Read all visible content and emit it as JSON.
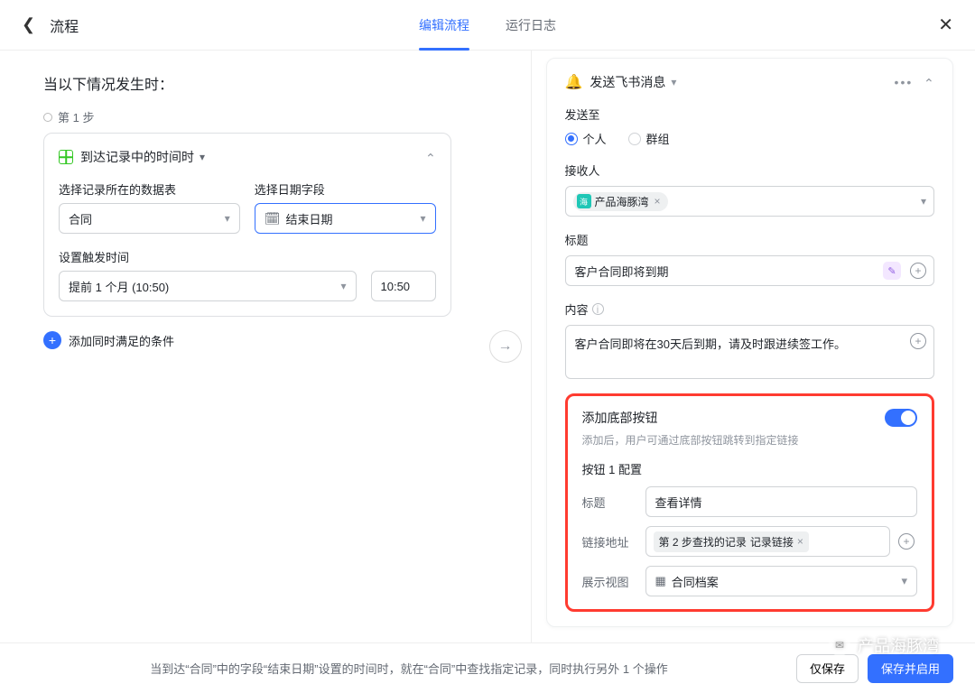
{
  "header": {
    "title": "流程",
    "tabs": [
      "编辑流程",
      "运行日志"
    ]
  },
  "left": {
    "section_title": "当以下情况发生时：",
    "step_label": "第 1 步",
    "card_title": "到达记录中的时间时",
    "label_table": "选择记录所在的数据表",
    "table_value": "合同",
    "label_date_field": "选择日期字段",
    "date_field_value": "结束日期",
    "label_trigger_time": "设置触发时间",
    "trigger_value": "提前 1 个月 (10:50)",
    "time_value": "10:50",
    "add_condition": "添加同时满足的条件"
  },
  "right": {
    "action_title": "发送飞书消息",
    "send_to_label": "发送至",
    "radio_person": "个人",
    "radio_group": "群组",
    "recipient_label": "接收人",
    "recipient_chip": "产品海豚湾",
    "title_label": "标题",
    "title_value": "客户合同即将到期",
    "content_label": "内容",
    "content_value": "客户合同即将在30天后到期，请及时跟进续签工作。",
    "add_bottom_btn_label": "添加底部按钮",
    "add_bottom_btn_hint": "添加后，用户可通过底部按钮跳转到指定链接",
    "btn1_cfg": "按钮 1 配置",
    "btn1_title_label": "标题",
    "btn1_title_value": "查看详情",
    "btn1_link_label": "链接地址",
    "btn1_link_tag_bold": "第 2 步查找的记录",
    "btn1_link_tag_rest": "记录链接",
    "btn1_view_label": "展示视图",
    "btn1_view_value": "合同档案"
  },
  "footer": {
    "summary": "当到达“合同”中的字段“结束日期”设置的时间时，就在“合同”中查找指定记录，同时执行另外 1 个操作",
    "save": "仅保存",
    "save_enable": "保存并启用"
  },
  "watermark": "产品海豚湾"
}
